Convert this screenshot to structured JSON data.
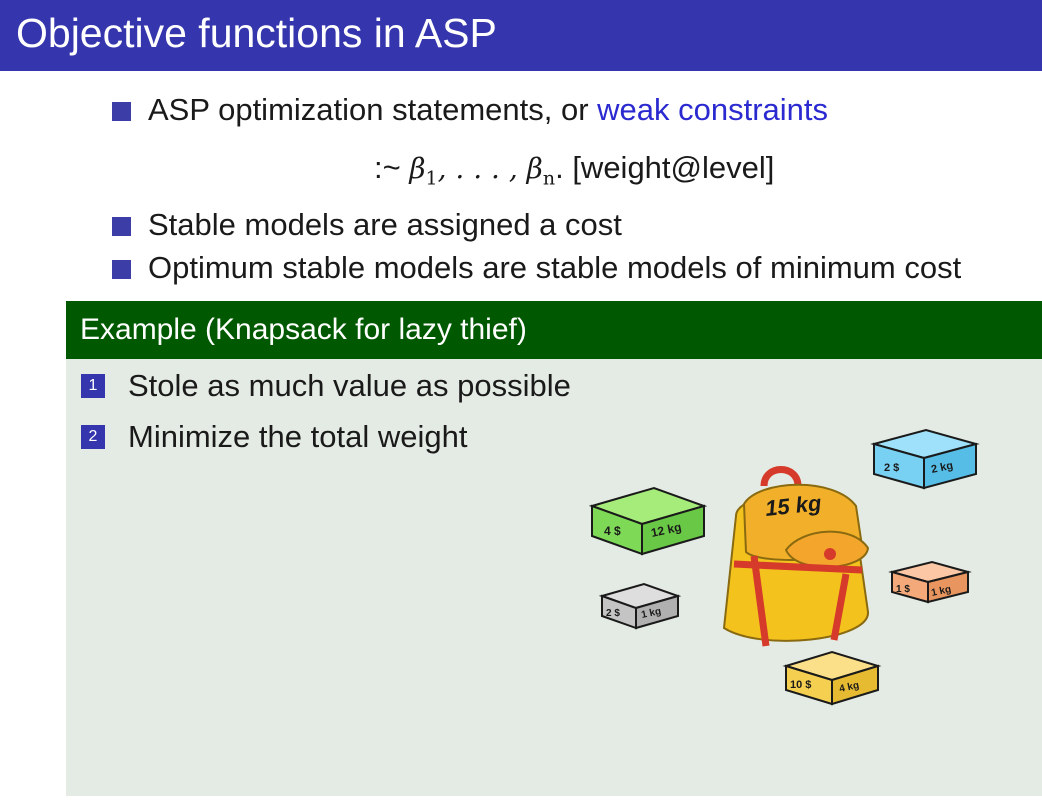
{
  "title": "Objective functions in ASP",
  "bullets": {
    "b1_prefix": "ASP optimization statements, or ",
    "b1_highlight": "weak constraints",
    "b2": "Stable models are assigned a cost",
    "b3": "Optimum stable models are stable models of minimum cost"
  },
  "formula": {
    "prefix": ":~ ",
    "beta": "β",
    "sub1": "1",
    "dots": ", . . . , ",
    "subn": "n",
    "period": ".",
    "bracket": " [weight@level]"
  },
  "example": {
    "title": "Example (Knapsack for lazy thief)",
    "items": [
      {
        "num": "1",
        "text": "Stole as much value as possible"
      },
      {
        "num": "2",
        "text": "Minimize the total weight"
      }
    ]
  },
  "knapsack": {
    "capacity": "15 kg",
    "boxes": [
      {
        "price": "4 $",
        "weight": "12 kg",
        "color": "#7ed957"
      },
      {
        "price": "2 $",
        "weight": "1 kg",
        "color": "#bdbdbd"
      },
      {
        "price": "2 $",
        "weight": "2 kg",
        "color": "#5ec8f0"
      },
      {
        "price": "1 $",
        "weight": "1 kg",
        "color": "#f4a97a"
      },
      {
        "price": "10 $",
        "weight": "4 kg",
        "color": "#f5cf50"
      }
    ]
  }
}
